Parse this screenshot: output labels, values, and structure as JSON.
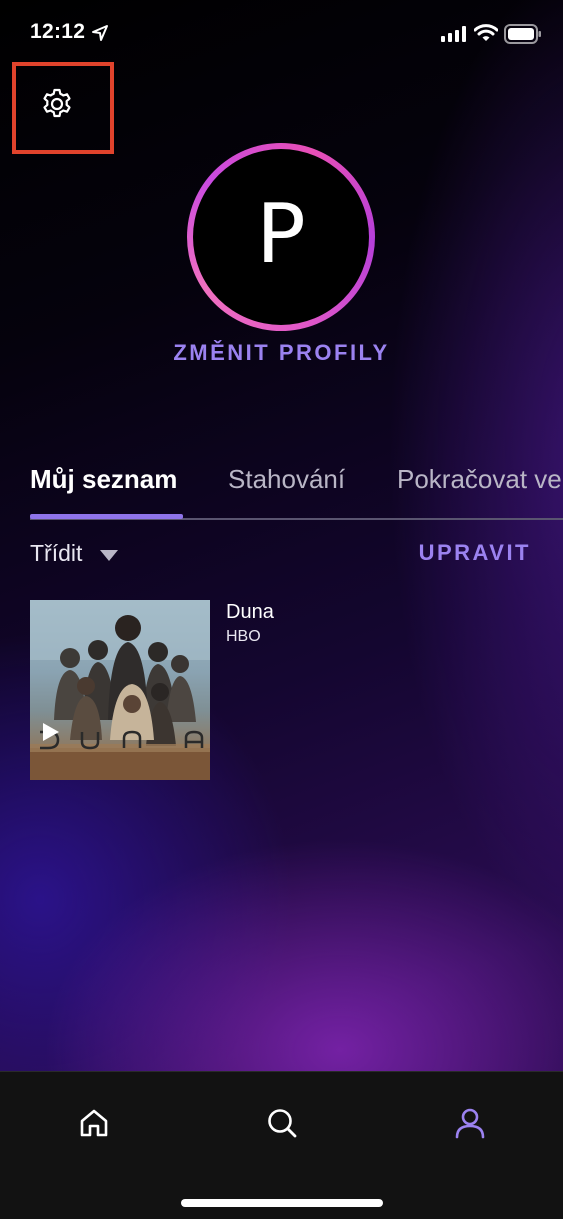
{
  "status_bar": {
    "time": "12:12"
  },
  "settings": {
    "icon": "gear-icon"
  },
  "profile": {
    "initial": "P",
    "change_profiles_label": "ZMĚNIT PROFILY"
  },
  "tabs": [
    {
      "label": "Můj seznam",
      "active": true
    },
    {
      "label": "Stahování",
      "active": false
    },
    {
      "label": "Pokračovat ve",
      "active": false
    }
  ],
  "list_controls": {
    "sort_label": "Třídit",
    "edit_label": "UPRAVIT"
  },
  "items": [
    {
      "title": "Duna",
      "channel": "HBO",
      "poster_text": "DUNA"
    }
  ],
  "bottom_nav": [
    {
      "icon": "home-icon",
      "active": false
    },
    {
      "icon": "search-icon",
      "active": false
    },
    {
      "icon": "profile-icon",
      "active": true
    }
  ],
  "colors": {
    "accent": "#9b82f0",
    "highlight_frame": "#e0432c",
    "avatar_ring": "#e84fb6"
  }
}
